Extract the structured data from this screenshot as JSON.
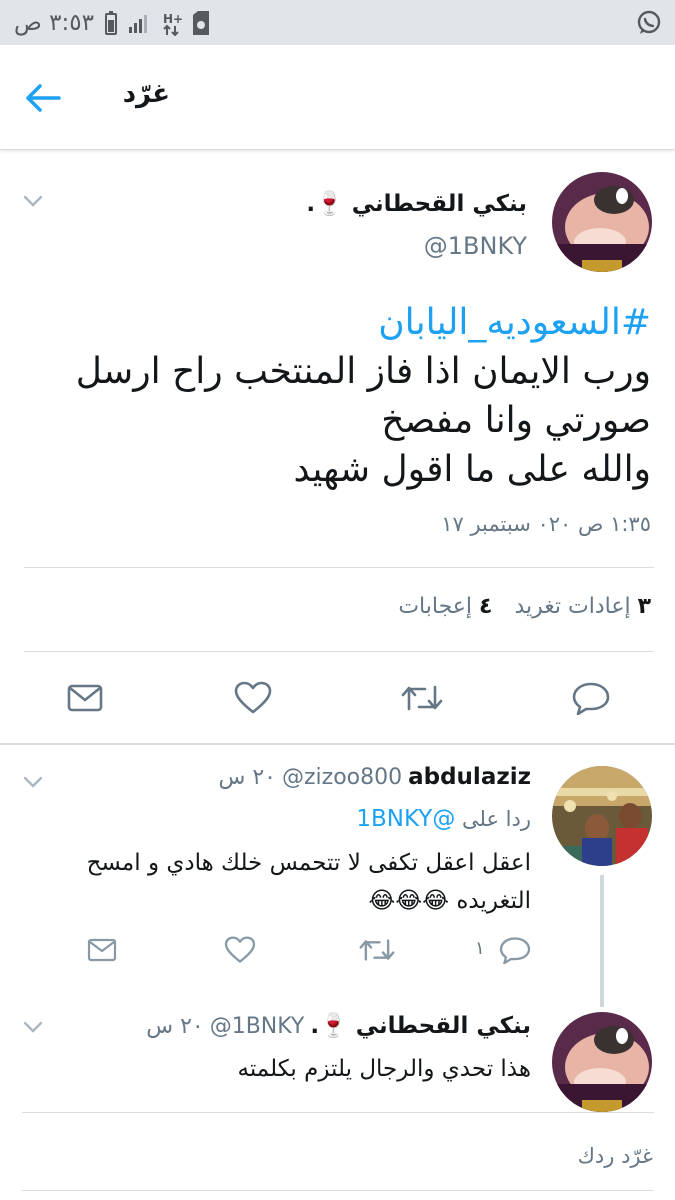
{
  "status_bar": {
    "time": "٣:٥٣ ص",
    "network": "H+",
    "icons": [
      "whatsapp-icon",
      "battery-icon",
      "signal-icon",
      "network-type-icon",
      "sim-icon"
    ]
  },
  "app_bar": {
    "title": "غرّد",
    "back_icon": "arrow-left-icon"
  },
  "main_tweet": {
    "display_name": "بنكي القحطاني 🍷.",
    "handle": "@1BNKY",
    "hashtag": "#السعوديه_اليابان",
    "text_lines": [
      "ورب الايمان اذا فاز المنتخب راح ارسل",
      "صورتي وانا مفصخ",
      "والله على ما اقول شهيد"
    ],
    "timestamp": "١:٣٥ ص ٠٢٠ سبتمبر ١٧",
    "retweets_count": "٣",
    "retweets_label": "إعادات تغريد",
    "likes_count": "٤",
    "likes_label": "إعجابات"
  },
  "reply_1": {
    "display_name": "abdulaziz",
    "handle": "@zizoo800",
    "time": "٢٠ س",
    "replying_to_label": "ردا على",
    "replying_to_handle": "@1BNKY",
    "text_line1": "اعقل اعقل تكفى لا تتحمس خلك هادي و امسح",
    "text_line2": "التغريده 😂😂😂",
    "reply_count": "١"
  },
  "reply_2": {
    "display_name": "بنكي القحطاني 🍷.",
    "handle": "@1BNKY",
    "time": "٢٠ س",
    "text": "هذا تحدي والرجال يلتزم بكلمته"
  },
  "compose": {
    "placeholder": "غرّد ردك"
  },
  "colors": {
    "accent": "#1da1f2",
    "secondary_text": "#657786",
    "primary_text": "#14171a",
    "status_bar_bg": "#e1e4e8"
  }
}
